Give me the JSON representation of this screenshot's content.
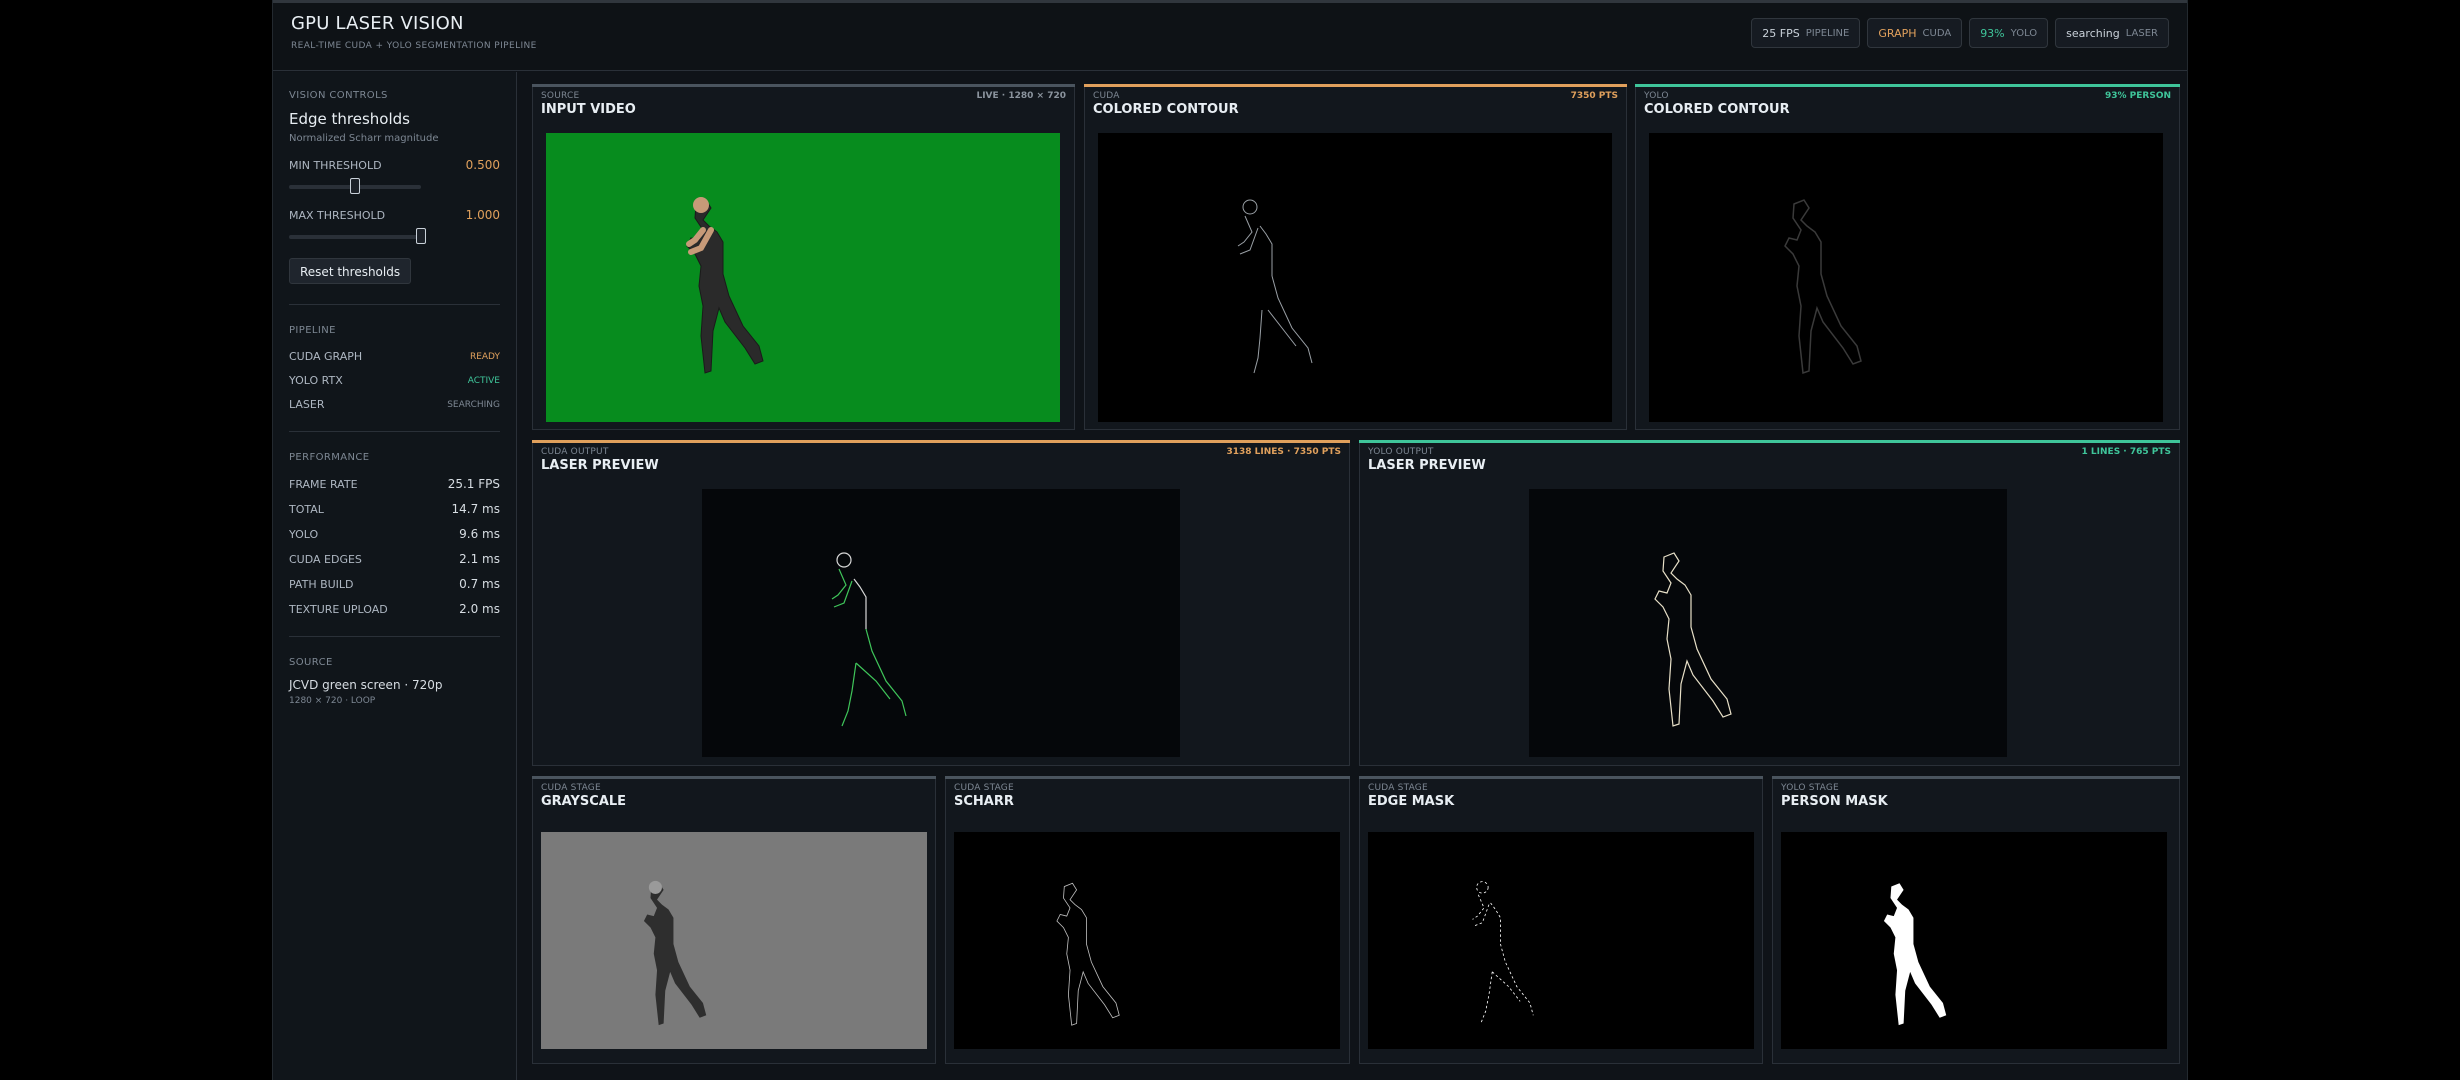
{
  "app": {
    "title": "GPU LASER VISION",
    "subtitle": "REAL-TIME CUDA + YOLO SEGMENTATION PIPELINE"
  },
  "status_pills": [
    {
      "value": "25 FPS",
      "key": "PIPELINE"
    },
    {
      "value": "GRAPH",
      "key": "CUDA"
    },
    {
      "value": "93%",
      "key": "YOLO"
    },
    {
      "value": "searching",
      "key": "LASER"
    }
  ],
  "sidebar": {
    "vision": {
      "label": "VISION CONTROLS",
      "title": "Edge thresholds",
      "subtitle": "Normalized Scharr magnitude",
      "min_label": "MIN THRESHOLD",
      "min_value": "0.500",
      "min_fraction": 0.5,
      "max_label": "MAX THRESHOLD",
      "max_value": "1.000",
      "max_fraction": 1.0,
      "reset_label": "Reset thresholds"
    },
    "pipeline": {
      "label": "PIPELINE",
      "items": [
        {
          "name": "CUDA GRAPH",
          "status": "READY"
        },
        {
          "name": "YOLO RTX",
          "status": "ACTIVE"
        },
        {
          "name": "LASER",
          "status": "SEARCHING"
        }
      ]
    },
    "performance": {
      "label": "PERFORMANCE",
      "items": [
        {
          "name": "FRAME RATE",
          "value": "25.1 FPS"
        },
        {
          "name": "TOTAL",
          "value": "14.7 ms"
        },
        {
          "name": "YOLO",
          "value": "9.6 ms"
        },
        {
          "name": "CUDA EDGES",
          "value": "2.1 ms"
        },
        {
          "name": "PATH BUILD",
          "value": "0.7 ms"
        },
        {
          "name": "TEXTURE UPLOAD",
          "value": "2.0 ms"
        }
      ]
    },
    "source": {
      "label": "SOURCE",
      "name": "JCVD green screen · 720p",
      "meta": "1280 × 720 · LOOP"
    }
  },
  "panels": {
    "input": {
      "kicker": "SOURCE",
      "title": "INPUT VIDEO",
      "badge": "LIVE · 1280 × 720"
    },
    "cuda_contour": {
      "kicker": "CUDA",
      "title": "COLORED CONTOUR",
      "badge": "7350 PTS"
    },
    "yolo_contour": {
      "kicker": "YOLO",
      "title": "COLORED CONTOUR",
      "badge": "93% PERSON"
    },
    "cuda_laser": {
      "kicker": "CUDA OUTPUT",
      "title": "LASER PREVIEW",
      "badge": "3138 LINES · 7350 PTS"
    },
    "yolo_laser": {
      "kicker": "YOLO OUTPUT",
      "title": "LASER PREVIEW",
      "badge": "1 LINES · 765 PTS"
    },
    "grayscale": {
      "kicker": "CUDA STAGE",
      "title": "GRAYSCALE"
    },
    "scharr": {
      "kicker": "CUDA STAGE",
      "title": "SCHARR"
    },
    "edge_mask": {
      "kicker": "CUDA STAGE",
      "title": "EDGE MASK"
    },
    "person_mask": {
      "kicker": "YOLO STAGE",
      "title": "PERSON MASK"
    }
  },
  "colors": {
    "amber": "#e0a05c",
    "green": "#3fc59a",
    "chroma_green": "#078c1e"
  }
}
